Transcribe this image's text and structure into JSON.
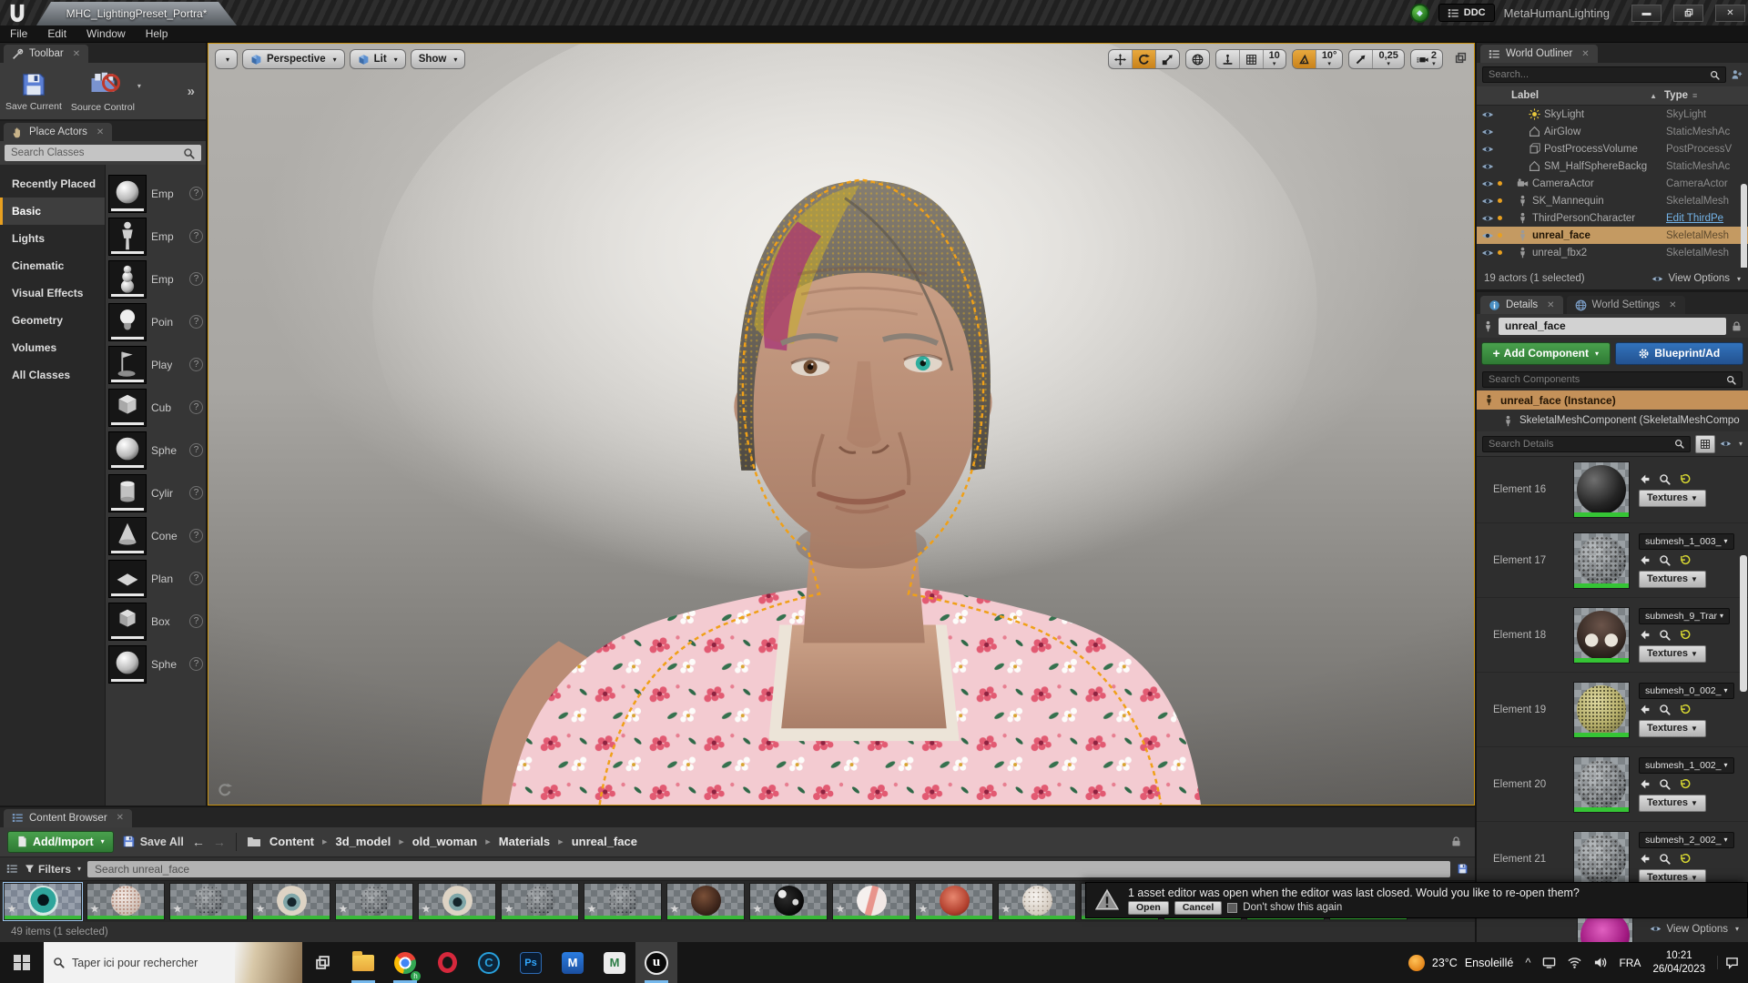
{
  "title_bar": {
    "tab_title": "MHC_LightingPreset_Portra*",
    "ddc_label": "DDC",
    "app_title": "MetaHumanLighting"
  },
  "menu": {
    "items": [
      "File",
      "Edit",
      "Window",
      "Help"
    ]
  },
  "toolbar_panel": {
    "title": "Toolbar",
    "save_current": "Save Current",
    "source_control": "Source Control",
    "expand": "»"
  },
  "place_actors": {
    "title": "Place Actors",
    "search_placeholder": "Search Classes",
    "help_badge": "?",
    "categories": [
      {
        "label": "Recently Placed"
      },
      {
        "label": "Basic",
        "active": true
      },
      {
        "label": "Lights"
      },
      {
        "label": "Cinematic"
      },
      {
        "label": "Visual Effects"
      },
      {
        "label": "Geometry"
      },
      {
        "label": "Volumes"
      },
      {
        "label": "All Classes"
      }
    ],
    "items": [
      {
        "label": "Emp",
        "icon": "#s-sphere"
      },
      {
        "label": "Emp",
        "icon": "#s-figure"
      },
      {
        "label": "Emp",
        "icon": "#s-stack"
      },
      {
        "label": "Poin",
        "icon": "#s-bulb"
      },
      {
        "label": "Play",
        "icon": "#s-flag"
      },
      {
        "label": "Cub",
        "icon": "#s-cube"
      },
      {
        "label": "Sphe",
        "icon": "#s-sphere"
      },
      {
        "label": "Cylir",
        "icon": "#s-cylinder"
      },
      {
        "label": "Cone",
        "icon": "#s-cone"
      },
      {
        "label": "Plan",
        "icon": "#s-plane"
      },
      {
        "label": "Box",
        "icon": "#s-box"
      },
      {
        "label": "Sphe",
        "icon": "#s-sphere"
      }
    ]
  },
  "viewport": {
    "perspective": "Perspective",
    "lit": "Lit",
    "show": "Show",
    "grid_value": "10",
    "angle_value": "10°",
    "scale_value": "0,25",
    "speed_value": "2"
  },
  "world_outliner": {
    "title": "World Outliner",
    "search_placeholder": "Search...",
    "col_label": "Label",
    "col_type": "Type",
    "rows": [
      {
        "label": "SkyLight",
        "type": "SkyLight",
        "icon": "#i-light",
        "indent2": true
      },
      {
        "label": "AirGlow",
        "type": "StaticMeshAc",
        "icon": "#i-house",
        "indent2": true
      },
      {
        "label": "PostProcessVolume",
        "type": "PostProcessV",
        "icon": "#i-fxvol",
        "indent2": true
      },
      {
        "label": "SM_HalfSphereBackg",
        "type": "StaticMeshAc",
        "icon": "#i-house",
        "indent2": true
      },
      {
        "label": "CameraActor",
        "type": "CameraActor",
        "icon": "#i-cam",
        "dot": true
      },
      {
        "label": "SK_Mannequin",
        "type": "SkeletalMesh",
        "icon": "#i-person",
        "dot": true
      },
      {
        "label": "ThirdPersonCharacter",
        "type": "Edit ThirdPe",
        "icon": "#i-person",
        "dot": true,
        "link": true
      },
      {
        "label": "unreal_face",
        "type": "SkeletalMesh",
        "icon": "#i-person",
        "dot": true,
        "selected": true
      },
      {
        "label": "unreal_fbx2",
        "type": "SkeletalMesh",
        "icon": "#i-person",
        "dot": true
      }
    ],
    "footer": "19 actors (1 selected)",
    "view_options": "View Options"
  },
  "details": {
    "tab_details": "Details",
    "tab_world_settings": "World Settings",
    "actor_name": "unreal_face",
    "add_component": "Add Component",
    "blueprint": "Blueprint/Ad",
    "search_components_placeholder": "Search Components",
    "instance_row": "unreal_face (Instance)",
    "component_row": "SkeletalMeshComponent (SkeletalMeshCompo",
    "search_details_placeholder": "Search Details",
    "view_options": "View Options",
    "elements": [
      {
        "label": "Element 16",
        "textures": "Textures",
        "sphere": "dark",
        "no_submesh": true
      },
      {
        "label": "Element 17",
        "submesh": "submesh_1_003_",
        "textures": "Textures",
        "sphere": "dots"
      },
      {
        "label": "Element 18",
        "submesh": "submesh_9_Trar",
        "textures": "Textures",
        "sphere": "mouth"
      },
      {
        "label": "Element 19",
        "submesh": "submesh_0_002_",
        "textures": "Textures",
        "sphere": "olive"
      },
      {
        "label": "Element 20",
        "submesh": "submesh_1_002_",
        "textures": "Textures",
        "sphere": "dots"
      },
      {
        "label": "Element 21",
        "submesh": "submesh_2_002_",
        "textures": "Textures",
        "sphere": "dots"
      }
    ]
  },
  "content_browser": {
    "title": "Content Browser",
    "add_import": "Add/Import",
    "save_all": "Save All",
    "breadcrumbs": [
      "Content",
      "3d_model",
      "old_woman",
      "Materials",
      "unreal_face"
    ],
    "filters": "Filters",
    "search_placeholder": "Search unreal_face",
    "status": "49 items (1 selected)",
    "thumbs": [
      {
        "kind": "eye-teal",
        "selected": true
      },
      {
        "kind": "speck"
      },
      {
        "kind": "checker"
      },
      {
        "kind": "eye"
      },
      {
        "kind": "checker"
      },
      {
        "kind": "eye"
      },
      {
        "kind": "checker"
      },
      {
        "kind": "checker"
      },
      {
        "kind": "brown"
      },
      {
        "kind": "black"
      },
      {
        "kind": "feather"
      },
      {
        "kind": "red"
      },
      {
        "kind": "pale"
      },
      {
        "kind": "pink"
      },
      {
        "kind": "cream"
      },
      {
        "kind": "cream"
      },
      {
        "kind": "cream"
      }
    ]
  },
  "notification": {
    "message": "1 asset editor was open when the editor was last closed. Would you like to re-open them?",
    "open": "Open",
    "cancel": "Cancel",
    "dont_show": "Don't show this again"
  },
  "taskbar": {
    "search_placeholder": "Taper ici pour rechercher",
    "chrome_badge": "h",
    "temperature": "23°C",
    "weather": "Ensoleillé",
    "language": "FRA",
    "time": "10:21",
    "date": "26/04/2023"
  }
}
